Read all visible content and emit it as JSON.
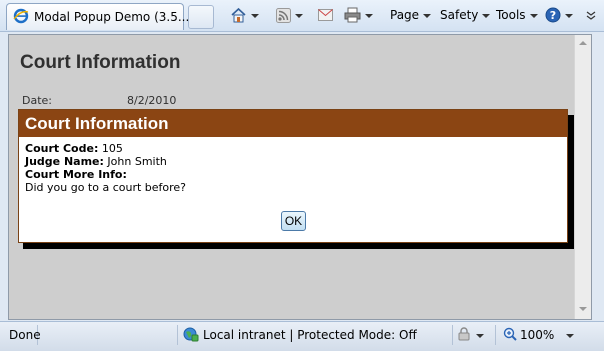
{
  "browser": {
    "tab_title": "Modal Popup Demo (3.5....",
    "commands": {
      "page": "Page",
      "safety": "Safety",
      "tools": "Tools"
    }
  },
  "page": {
    "title": "Court Information",
    "date_label": "Date:",
    "date_value": "8/2/2010"
  },
  "modal": {
    "title": "Court Information",
    "court_code_label": "Court Code:",
    "court_code_value": "105",
    "judge_name_label": "Judge Name:",
    "judge_name_value": "John Smith",
    "more_info_label": "Court More Info:",
    "more_info_value": "Did you go to a court before?",
    "ok_label": "OK"
  },
  "status": {
    "text": "Done",
    "zone": "Local intranet | Protected Mode: Off",
    "zoom": "100%"
  },
  "colors": {
    "modal_header": "#8b4513",
    "page_background": "#cecece"
  }
}
